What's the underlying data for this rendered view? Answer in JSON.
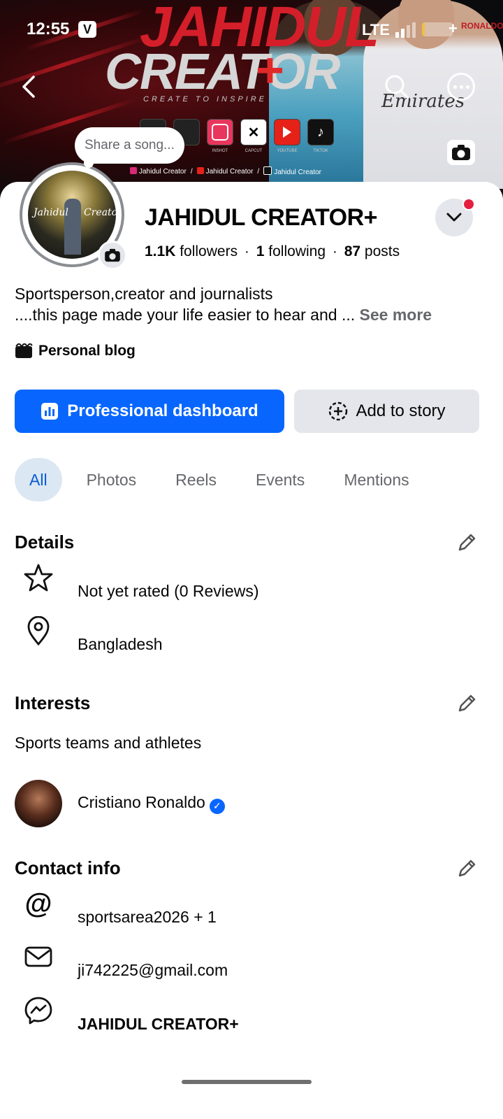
{
  "status_bar": {
    "time": "12:55",
    "carrier_badge": "V",
    "network": "LTE"
  },
  "cover": {
    "title_line1": "JAHIDUL",
    "title_line2": "CREATOR",
    "title_plus": "+",
    "tagline": "CREATE TO INSPIRE",
    "apps": [
      "INSHOT",
      "CAPCUT",
      "YOUTUBE",
      "TIKTOK"
    ],
    "social": [
      "Jahidul Creator",
      "Jahidul Creator",
      "Jahidul Creator"
    ],
    "jersey_text": "Emirates",
    "corner_text": "RONALDO"
  },
  "song_bubble": "Share a song...",
  "profile": {
    "name": "JAHIDUL CREATOR+",
    "followers_count": "1.1K",
    "followers_label": "followers",
    "following_count": "1",
    "following_label": "following",
    "posts_count": "87",
    "posts_label": "posts",
    "avatar_text_left": "Jahidul",
    "avatar_text_right": "Creator"
  },
  "bio": {
    "line1": "Sportsperson,creator and journalists",
    "line2": "....this page made your life easier to hear and ...",
    "see_more": "See more",
    "category": "Personal blog"
  },
  "buttons": {
    "professional_dashboard": "Professional dashboard",
    "add_to_story": "Add to story"
  },
  "tabs": [
    "All",
    "Photos",
    "Reels",
    "Events",
    "Mentions"
  ],
  "details": {
    "heading": "Details",
    "rating": "Not yet rated (0 Reviews)",
    "location": "Bangladesh"
  },
  "interests": {
    "heading": "Interests",
    "category": "Sports teams and athletes",
    "item": "Cristiano Ronaldo"
  },
  "contact": {
    "heading": "Contact info",
    "social": "sportsarea2026 + 1",
    "email": "ji742225@gmail.com",
    "messenger": "JAHIDUL CREATOR+"
  },
  "colors": {
    "accent": "#0866ff",
    "tab_active_bg": "#dbe7f2",
    "secondary_button": "#e4e6eb",
    "notification": "#e41e3f"
  }
}
